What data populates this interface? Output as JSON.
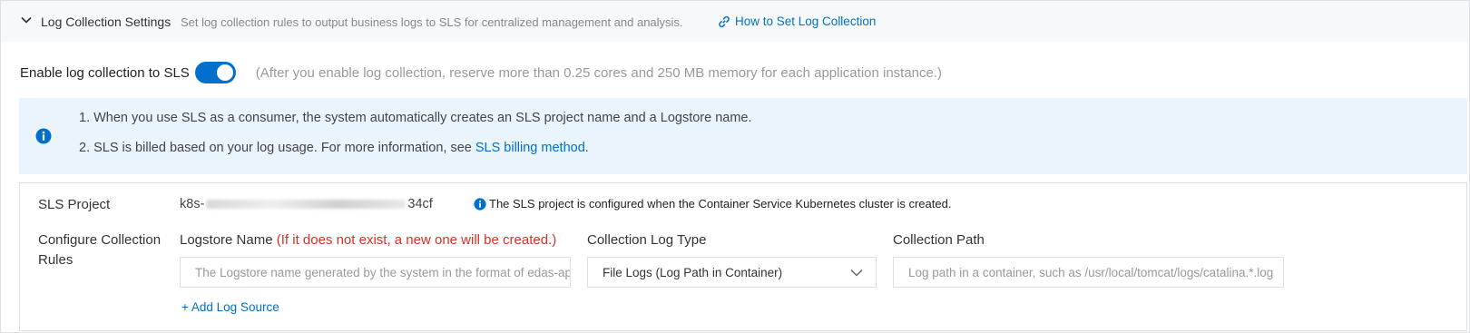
{
  "header": {
    "title": "Log Collection Settings",
    "description": "Set log collection rules to output business logs to SLS for centralized management and analysis.",
    "link_label": "How to Set Log Collection"
  },
  "toggle": {
    "label": "Enable log collection to SLS",
    "enabled": true,
    "hint": "(After you enable log collection, reserve more than 0.25 cores and 250 MB memory for each application instance.)"
  },
  "info": {
    "line1": "1. When you use SLS as a consumer, the system automatically creates an SLS project name and a Logstore name.",
    "line2_prefix": "2. SLS is billed based on your log usage. For more information, see ",
    "line2_link": "SLS billing method",
    "line2_suffix": "."
  },
  "project": {
    "label": "SLS Project",
    "value_prefix": "k8s-",
    "value_suffix": "34cf",
    "note": "The SLS project is configured when the Container Service Kubernetes cluster is created."
  },
  "rules": {
    "label": "Configure Collection Rules",
    "logstore_label": "Logstore Name",
    "logstore_note": "(If it does not exist, a new one will be created.)",
    "logstore_placeholder": "The Logstore name generated by the system in the format of edas-ap",
    "type_label": "Collection Log Type",
    "type_value": "File Logs (Log Path in Container)",
    "path_label": "Collection Path",
    "path_placeholder": "Log path in a container, such as /usr/local/tomcat/logs/catalina.*.log",
    "add_source": "+ Add Log Source"
  },
  "colors": {
    "accent": "#0070cc",
    "required": "#d93026",
    "info_bg": "#eaf4fd"
  }
}
